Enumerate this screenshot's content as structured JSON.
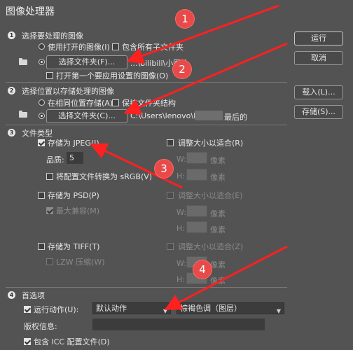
{
  "window": {
    "title": "图像处理器"
  },
  "section1": {
    "num": "1",
    "title": "选择要处理的图像",
    "use_open_label": "使用打开的图像(I)",
    "include_subfolders_label": "包含所有子文件夹",
    "select_folder_btn": "选择文件夹(F)...",
    "path_text": "...\\bilibili\\小图片",
    "open_first_label": "打开第一个要应用设置的图像(O)"
  },
  "section2": {
    "num": "2",
    "title": "选择位置以存储处理的图像",
    "same_location_label": "在相同位置存储(A)",
    "keep_structure_label": "保持文件夹结构",
    "select_folder_btn": "选择文件夹(C)...",
    "path_text": "C:\\Users\\lenovo\\De",
    "path_suffix": "最后的"
  },
  "section3": {
    "num": "3",
    "title": "文件类型",
    "jpeg": {
      "save_label": "存储为 JPEG(J)",
      "quality_label": "品质:",
      "quality_value": "5",
      "srgb_label": "将配置文件转换为 sRGB(V)",
      "resize_label": "调整大小以适合(R)",
      "w_label": "W:",
      "h_label": "H:",
      "unit": "像素"
    },
    "psd": {
      "save_label": "存储为 PSD(P)",
      "max_compat_label": "最大兼容(M)",
      "resize_label": "调整大小以适合(E)",
      "w_label": "W:",
      "h_label": "H:",
      "unit": "像素"
    },
    "tiff": {
      "save_label": "存储为 TIFF(T)",
      "lzw_label": "LZW 压缩(W)",
      "resize_label": "调整大小以适合(Z)",
      "w_label": "W:",
      "h_label": "H:",
      "unit": "像素"
    }
  },
  "section4": {
    "num": "4",
    "title": "首选项",
    "run_action_label": "运行动作(U):",
    "action_set": "默认动作",
    "action": "棕褐色调（图层）",
    "copyright_label": "版权信息:",
    "include_icc_label": "包含 ICC 配置文件(D)"
  },
  "buttons": {
    "run": "运行",
    "cancel": "取消",
    "load": "载入(L)...",
    "save": "存储(S)..."
  },
  "annotations": [
    "1",
    "2",
    "3",
    "4"
  ],
  "colors": {
    "bg": "#535353",
    "annotation_red": "#ff2020"
  }
}
